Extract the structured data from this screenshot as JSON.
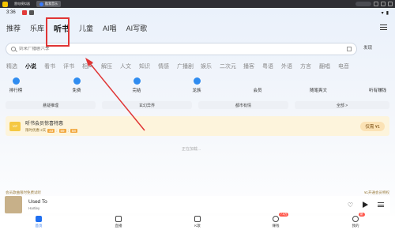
{
  "emulator": {
    "tabs": [
      {
        "label": "雷电模拟器"
      },
      {
        "label": "酷我音乐"
      }
    ]
  },
  "statusbar": {
    "time": "3:36"
  },
  "topnav": {
    "tabs": [
      "推荐",
      "乐库",
      "听书",
      "儿童",
      "AI唱",
      "AI写歌"
    ]
  },
  "search": {
    "placeholder": "剑来广播剧六季",
    "discover_label": "发现"
  },
  "categories": [
    "精选",
    "小说",
    "看书",
    "评书",
    "相声",
    "解压",
    "人文",
    "知识",
    "情感",
    "广播剧",
    "娱乐",
    "二次元",
    "播客",
    "粤语",
    "外语",
    "方言",
    "翻唱",
    "电音"
  ],
  "icon_row": [
    {
      "label": "排行榜"
    },
    {
      "label": "免费"
    },
    {
      "label": "完结"
    },
    {
      "label": "龙族"
    },
    {
      "label": "会员"
    },
    {
      "label": "随笔爽文"
    },
    {
      "label": "听有赚钱"
    }
  ],
  "pills": [
    "悬疑推理",
    "玄幻异界",
    "都市有情",
    "全部 >"
  ],
  "banner": {
    "title": "听书会员惊喜特惠",
    "sub_prefix": "限时优惠 2天",
    "time_h": "23",
    "time_m": "59",
    "time_s": "58",
    "button_label": "仅需 ¥1"
  },
  "loading_text": "正在加载...",
  "privilege": {
    "left": "会员歌曲限时免费试听",
    "right": "¥1开通会员特权"
  },
  "player": {
    "song": "Used To",
    "artist": "Hartley"
  },
  "bottomnav": [
    {
      "label": "首页"
    },
    {
      "label": "直播"
    },
    {
      "label": "K歌"
    },
    {
      "label": "赚钱",
      "badge": "7.6万"
    },
    {
      "label": "我的",
      "badge": "新"
    }
  ],
  "colors": {
    "highlight": "#e03535",
    "accent": "#1f6ff0"
  }
}
